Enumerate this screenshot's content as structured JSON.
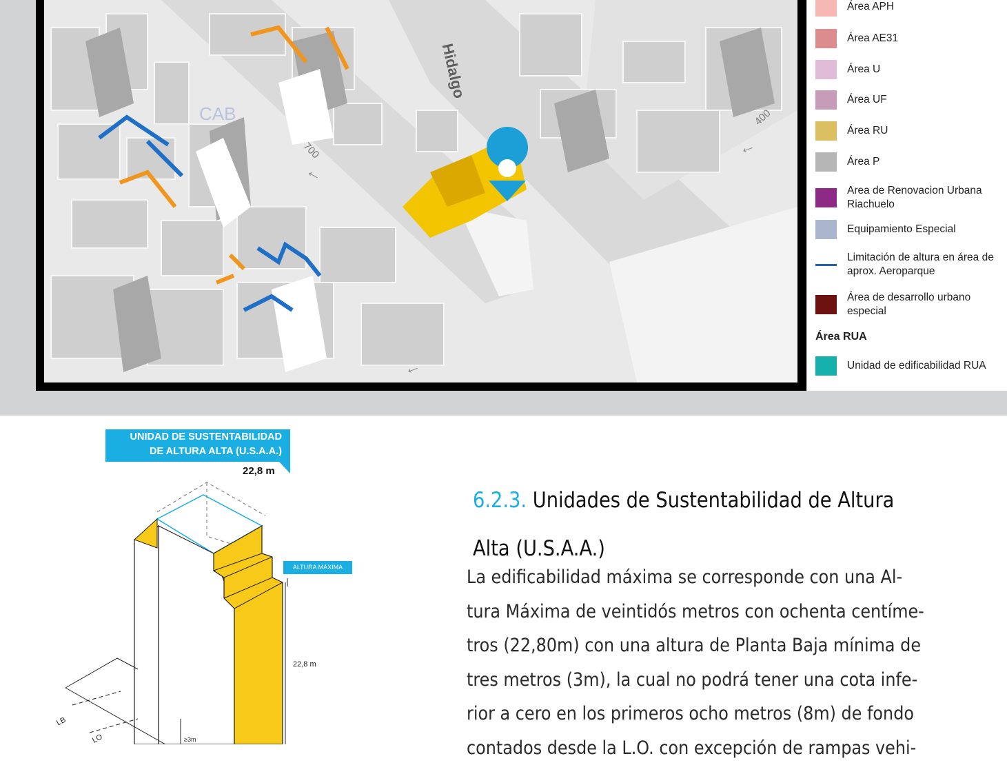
{
  "map": {
    "street_name": "Hidalgo",
    "numbers": [
      "700",
      "400"
    ],
    "direction_arrows": [
      "arrow-left",
      "arrow-left",
      "arrow-left"
    ],
    "overlay_text": "CAB",
    "marker_icon": "map-pin-icon",
    "colors": {
      "highlight_building": "#f2c500",
      "marker": "#1b9fd6",
      "orange_outline": "#f0961e",
      "blue_outline": "#1f6fc6"
    }
  },
  "legend": {
    "items": [
      {
        "label": "Área APH",
        "color": "#f7b8b4"
      },
      {
        "label": "Área AE31",
        "color": "#dc8c8f"
      },
      {
        "label": "Área U",
        "color": "#e0bcd8"
      },
      {
        "label": "Área UF",
        "color": "#c79cb8"
      },
      {
        "label": "Área RU",
        "color": "#dbbf60"
      },
      {
        "label": "Área P",
        "color": "#b6b6b6"
      },
      {
        "label": "Area de Renovacion Urbana Riachuelo",
        "color": "#8e2a86"
      },
      {
        "label": "Equipamiento Especial",
        "color": "#a9b6cd"
      },
      {
        "label": "Limitación de altura en área de aprox. Aeroparque",
        "color": "#1f5fb6"
      },
      {
        "label": "Área de desarrollo urbano especial",
        "color": "#6e1111"
      }
    ],
    "heading": "Área RUA",
    "rua_item": {
      "label": "Unidad de edificabilidad RUA",
      "color": "#17b1ad"
    }
  },
  "diagram": {
    "banner_line1": "UNIDAD DE SUSTENTABILIDAD",
    "banner_line2": "DE ALTURA ALTA (U.S.A.A.)",
    "banner_height": "22,8 m",
    "tag": "ALTURA MÁXIMA",
    "dimension": "22,8 m",
    "ground_min": "≥3m",
    "lb": "LB",
    "lo": "LO",
    "colors": {
      "banner": "#1aaee3",
      "building": "#f7c919"
    }
  },
  "section": {
    "number": "6.2.3.",
    "title_line1": "Unidades de Sustentabilidad de Altura",
    "title_line2": "Alta (U.S.A.A.)",
    "body_lines": [
      "La edificabilidad máxima se corresponde con una Al-",
      "tura Máxima de veintidós metros con ochenta centíme-",
      "tros (22,80m) con una altura de Planta Baja mínima de",
      "tres metros (3m), la cual no podrá tener una cota infe-",
      "rior a cero en los primeros ocho metros (8m) de fondo",
      "contados desde la L.O. con excepción de rampas vehi-"
    ]
  }
}
